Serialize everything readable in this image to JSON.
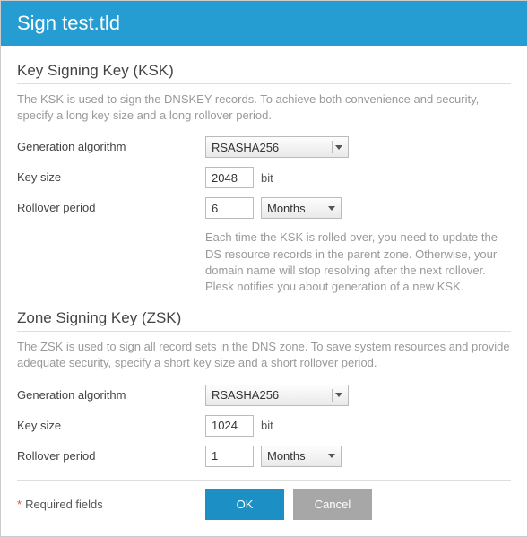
{
  "title": "Sign test.tld",
  "ksk": {
    "heading": "Key Signing Key (KSK)",
    "description": "The KSK is used to sign the DNSKEY records. To achieve both convenience and security, specify a long key size and a long rollover period.",
    "algo_label": "Generation algorithm",
    "algo_value": "RSASHA256",
    "size_label": "Key size",
    "size_value": "2048",
    "size_unit": "bit",
    "rollover_label": "Rollover period",
    "rollover_value": "6",
    "rollover_unit": "Months",
    "rollover_hint": "Each time the KSK is rolled over, you need to update the DS resource records in the parent zone. Otherwise, your domain name will stop resolving after the next rollover. Plesk notifies you about generation of a new KSK."
  },
  "zsk": {
    "heading": "Zone Signing Key (ZSK)",
    "description": "The ZSK is used to sign all record sets in the DNS zone. To save system resources and provide adequate security, specify a short key size and a short rollover period.",
    "algo_label": "Generation algorithm",
    "algo_value": "RSASHA256",
    "size_label": "Key size",
    "size_value": "1024",
    "size_unit": "bit",
    "rollover_label": "Rollover period",
    "rollover_value": "1",
    "rollover_unit": "Months"
  },
  "footer": {
    "required_label": "Required fields",
    "ok": "OK",
    "cancel": "Cancel"
  }
}
